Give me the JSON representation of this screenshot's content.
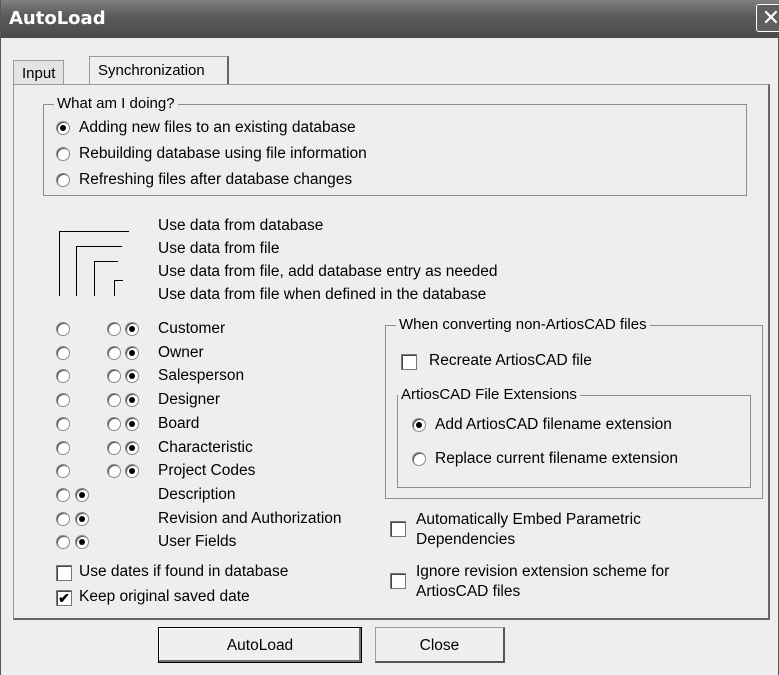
{
  "window": {
    "title": "AutoLoad",
    "close_symbol": "✕"
  },
  "tabs": [
    {
      "label": "Input",
      "active": false
    },
    {
      "label": "Synchronization",
      "active": true
    }
  ],
  "mode_group": {
    "title": "What am I doing?",
    "options": [
      {
        "label": "Adding new files to an existing database",
        "selected": true
      },
      {
        "label": "Rebuilding database using file information",
        "selected": false
      },
      {
        "label": "Refreshing files after database changes",
        "selected": false
      }
    ]
  },
  "column_legend": [
    "Use data from database",
    "Use data from file",
    "Use data from file, add database entry as needed",
    "Use data from file when defined in the database"
  ],
  "fields": [
    {
      "label": "Customer",
      "choice": 3
    },
    {
      "label": "Owner",
      "choice": 3
    },
    {
      "label": "Salesperson",
      "choice": 3
    },
    {
      "label": "Designer",
      "choice": 3
    },
    {
      "label": "Board",
      "choice": 3
    },
    {
      "label": "Characteristic",
      "choice": 3
    },
    {
      "label": "Project Codes",
      "choice": 3
    },
    {
      "label": "Description",
      "choice": 1
    },
    {
      "label": "Revision and Authorization",
      "choice": 1
    },
    {
      "label": "User Fields",
      "choice": 1
    }
  ],
  "left_checks": [
    {
      "label": "Use dates if found in database",
      "checked": false
    },
    {
      "label": "Keep original saved date",
      "checked": true
    }
  ],
  "converting_group": {
    "title": "When converting non-ArtiosCAD files",
    "recreate": {
      "label": "Recreate ArtiosCAD file",
      "checked": false
    },
    "ext_group": {
      "title": "ArtiosCAD File Extensions",
      "options": [
        {
          "label": "Add ArtiosCAD filename extension",
          "selected": true
        },
        {
          "label": "Replace current filename extension",
          "selected": false
        }
      ]
    }
  },
  "right_checks": [
    {
      "line1": "Automatically Embed Parametric",
      "line2": "Dependencies",
      "checked": false
    },
    {
      "line1": "Ignore revision extension scheme for",
      "line2": "ArtiosCAD files",
      "checked": false
    }
  ],
  "buttons": {
    "autoload": "AutoLoad",
    "close": "Close"
  },
  "check_mark": "✔"
}
